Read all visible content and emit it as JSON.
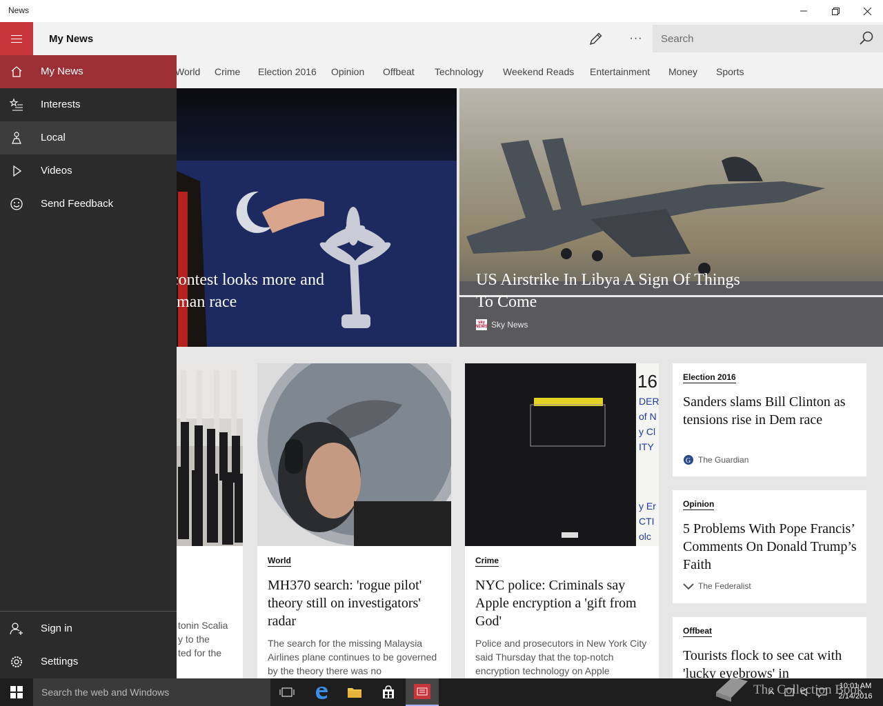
{
  "window": {
    "title": "News"
  },
  "header": {
    "page_title": "My News",
    "search_placeholder": "Search",
    "more_label": "···"
  },
  "categories": [
    "World",
    "Crime",
    "Election 2016",
    "Opinion",
    "Offbeat",
    "Technology",
    "Weekend Reads",
    "Entertainment",
    "Money",
    "Sports"
  ],
  "nav": {
    "items": [
      {
        "label": "My News",
        "icon": "home-icon"
      },
      {
        "label": "Interests",
        "icon": "interests-icon"
      },
      {
        "label": "Local",
        "icon": "local-icon"
      },
      {
        "label": "Videos",
        "icon": "play-icon"
      },
      {
        "label": "Send Feedback",
        "icon": "smiley-icon"
      }
    ],
    "bottom": [
      {
        "label": "Sign in",
        "icon": "person-add-icon"
      },
      {
        "label": "Settings",
        "icon": "gear-icon"
      }
    ]
  },
  "hero": [
    {
      "title_line1": "contest looks more and",
      "title_line2": "-man race"
    },
    {
      "title_line1": "US Airstrike In Libya A Sign Of Things",
      "title_line2": "To Come",
      "source": "Sky News",
      "source_logo": "sky NEWS"
    }
  ],
  "cards": [
    {
      "title": "nily pays",
      "desc": "tonin Scalia\ny to the\nted for the"
    },
    {
      "tag": "World",
      "title": "MH370 search: 'rogue pilot' theory still on investigators' radar",
      "desc": "The search for the missing Malaysia Airlines plane continues to be governed by the theory there was no"
    },
    {
      "tag": "Crime",
      "title": "NYC police: Criminals say Apple encryption a 'gift from God'",
      "desc": "Police and prosecutors in New York City said Thursday that the top-notch encryption technology on Apple"
    },
    {
      "tag": "Election 2016",
      "title": "Sanders slams Bill Clinton as tensions rise in Dem race",
      "source": "The Guardian"
    },
    {
      "tag": "Opinion",
      "title": "5 Problems With Pope Francis’ Comments On Donald Trump’s Faith",
      "source": "The Federalist"
    },
    {
      "tag": "Offbeat",
      "title": "Tourists flock to see cat with 'lucky eyebrows' in"
    }
  ],
  "taskbar": {
    "search_placeholder": "Search the web and Windows",
    "time": "10:01 AM",
    "date": "2/14/2016"
  },
  "watermark": "The Collection Book",
  "colors": {
    "accent": "#c8363b",
    "accent_selected": "#9b2f33",
    "pane": "#2b2b2b",
    "taskbar": "#1e1e1e"
  }
}
